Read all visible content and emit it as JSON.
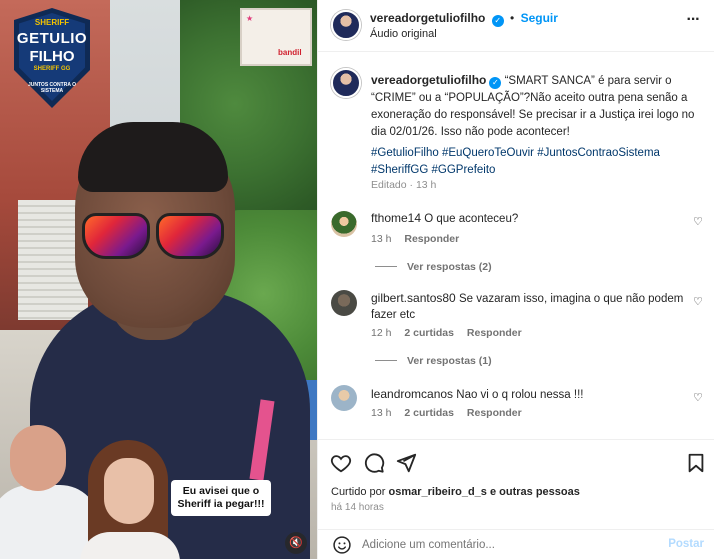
{
  "video_overlay": {
    "badge_top": "SHERIFF",
    "badge_line1": "GETULIO",
    "badge_line2": "FILHO",
    "badge_sub": "SHERIFF GG",
    "badge_bottom": "JUNTOS CONTRA O SISTEMA",
    "speech_text": "Eu avisei que o Sheriff ia pegar!!!",
    "sign_text": "bandil"
  },
  "header": {
    "username": "vereadorgetuliofilho",
    "follow_label": "Seguir",
    "audio_label": "Áudio original",
    "more_icon": "more-options-icon"
  },
  "caption": {
    "username": "vereadorgetuliofilho",
    "text": "“SMART SANCA” é para servir o “CRIME” ou a “POPULAÇÃO”?Não aceito outra pena senão a exoneração do responsável! Se precisar ir a Justiça irei logo no dia 02/01/26. Isso não pode acontecer!",
    "hashtags": "#GetulioFilho #EuQueroTeOuvir #JuntosContraoSistema #SheriffGG #GGPrefeito",
    "edited": "Editado · 13 h"
  },
  "comments": [
    {
      "username": "fthome14",
      "text": "O que aconteceu?",
      "time": "13 h",
      "likes": "",
      "reply_label": "Responder",
      "view_replies": "Ver respostas (2)"
    },
    {
      "username": "gilbert.santos80",
      "text": "Se vazaram isso, imagina o que não podem fazer etc",
      "time": "12 h",
      "likes": "2 curtidas",
      "reply_label": "Responder",
      "view_replies": "Ver respostas (1)"
    },
    {
      "username": "leandromcanos",
      "text": "Nao vi o q rolou nessa !!!",
      "time": "13 h",
      "likes": "2 curtidas",
      "reply_label": "Responder",
      "view_replies": ""
    }
  ],
  "actions": {
    "liked_by_prefix": "Curtido por",
    "liked_by_user": "osmar_ribeiro_d_s",
    "liked_by_suffix": "e outras pessoas",
    "posted_ago": "há 14 horas"
  },
  "add_comment": {
    "placeholder": "Adicione um comentário...",
    "post_label": "Postar"
  },
  "colors": {
    "accent": "#0095f6",
    "hashtag": "#00376b",
    "muted": "#737373"
  }
}
